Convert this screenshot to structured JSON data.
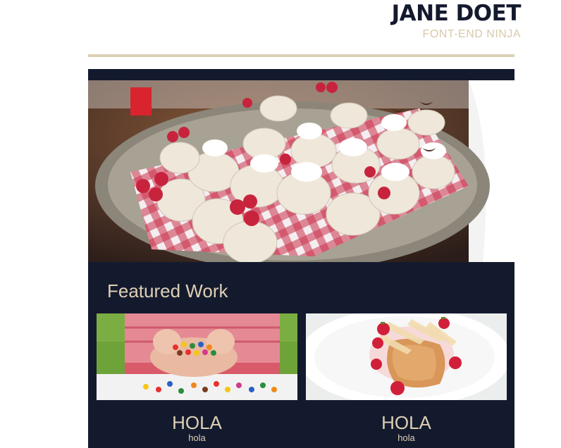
{
  "header": {
    "name": "JANE DOET",
    "tagline": "FONT-END NINJA"
  },
  "hero": {
    "image": "dessert-jars-on-tray-photo"
  },
  "featured": {
    "title": "Featured Work",
    "items": [
      {
        "image": "candy-in-hands-photo",
        "title": "HOLA",
        "subtitle": "hola"
      },
      {
        "image": "pastry-with-strawberries-photo",
        "title": "HOLA",
        "subtitle": "hola"
      }
    ]
  },
  "colors": {
    "navy": "#141a2e",
    "beige": "#ddd0b4"
  }
}
